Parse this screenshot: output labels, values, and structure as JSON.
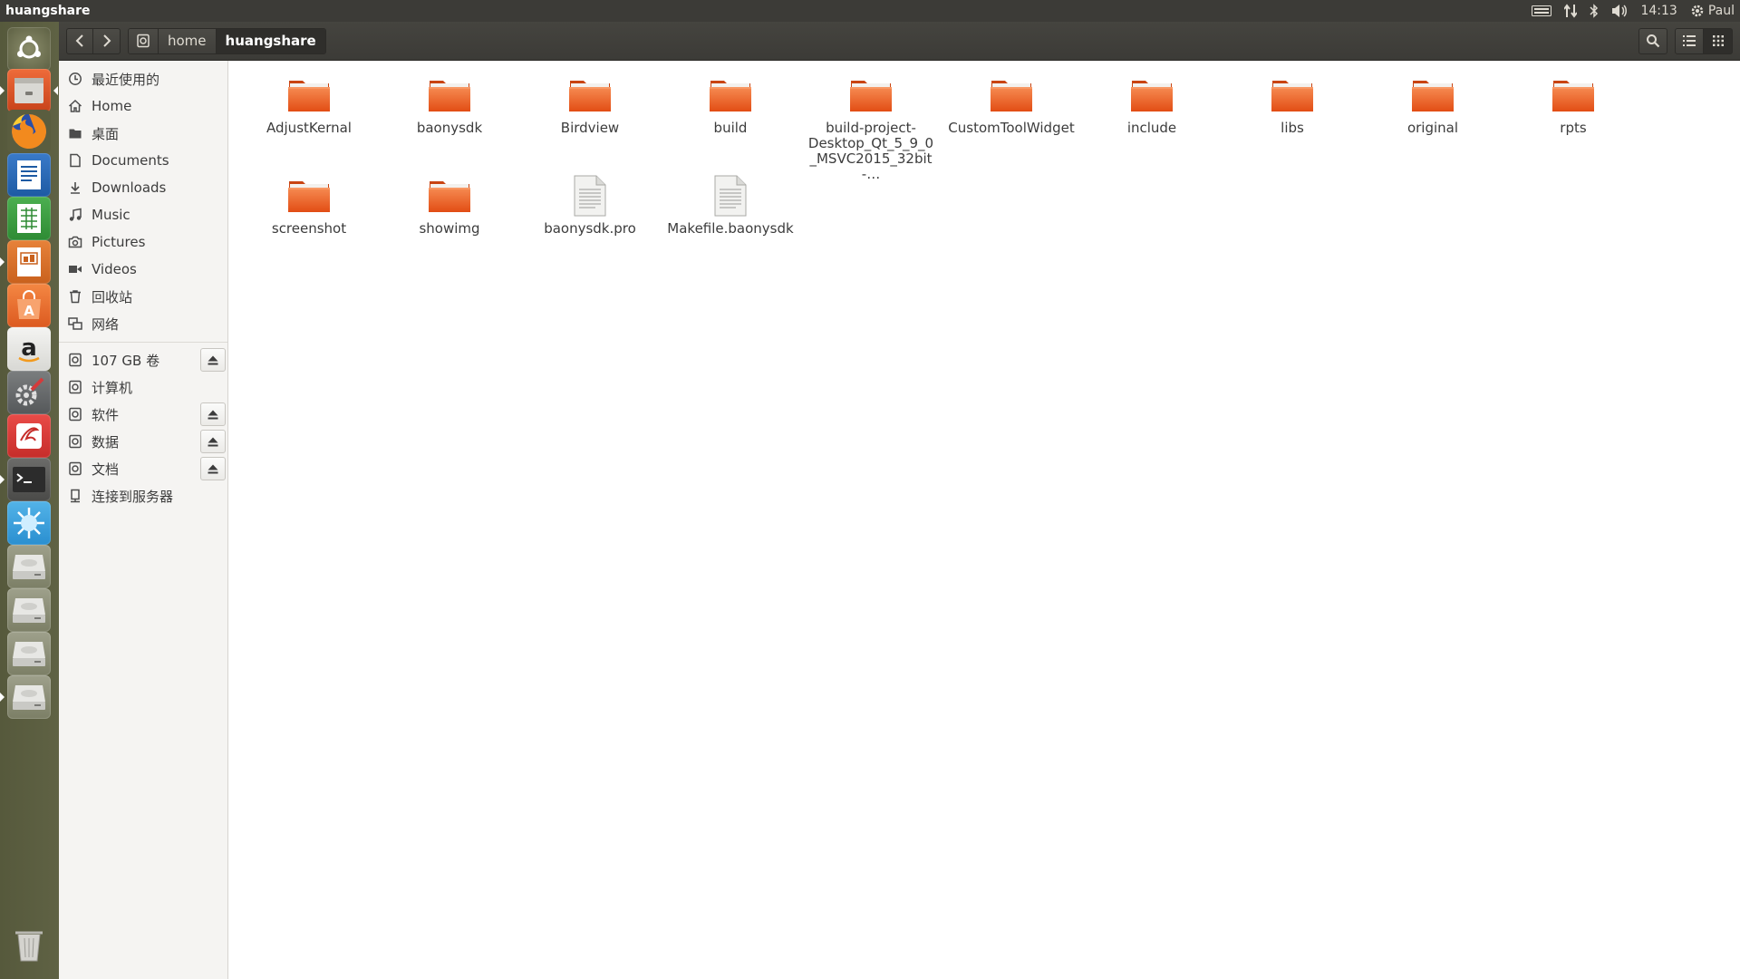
{
  "window": {
    "title": "huangshare"
  },
  "indicators": {
    "time": "14:13",
    "user": "Paul"
  },
  "pathbar": {
    "crumbs": [
      "home",
      "huangshare"
    ]
  },
  "sidebar": {
    "places": [
      {
        "label": "最近使用的",
        "icon": "clock-icon"
      },
      {
        "label": "Home",
        "icon": "home-icon"
      },
      {
        "label": "桌面",
        "icon": "folder-icon"
      },
      {
        "label": "Documents",
        "icon": "document-icon"
      },
      {
        "label": "Downloads",
        "icon": "download-icon"
      },
      {
        "label": "Music",
        "icon": "music-icon"
      },
      {
        "label": "Pictures",
        "icon": "camera-icon"
      },
      {
        "label": "Videos",
        "icon": "video-icon"
      },
      {
        "label": "回收站",
        "icon": "trash-icon"
      },
      {
        "label": "网络",
        "icon": "network-icon"
      }
    ],
    "devices": [
      {
        "label": "107 GB 卷",
        "icon": "drive-icon",
        "eject": true
      },
      {
        "label": "计算机",
        "icon": "drive-icon",
        "eject": false
      },
      {
        "label": "软件",
        "icon": "drive-icon",
        "eject": true
      },
      {
        "label": "数据",
        "icon": "drive-icon",
        "eject": true
      },
      {
        "label": "文档",
        "icon": "drive-icon",
        "eject": true
      },
      {
        "label": "连接到服务器",
        "icon": "server-icon",
        "eject": false
      }
    ]
  },
  "files": [
    {
      "name": "AdjustKernal",
      "type": "folder"
    },
    {
      "name": "baonysdk",
      "type": "folder"
    },
    {
      "name": "Birdview",
      "type": "folder"
    },
    {
      "name": "build",
      "type": "folder"
    },
    {
      "name": "build-project-Desktop_Qt_5_9_0_MSVC2015_32bit-…",
      "type": "folder"
    },
    {
      "name": "CustomToolWidget",
      "type": "folder"
    },
    {
      "name": "include",
      "type": "folder"
    },
    {
      "name": "libs",
      "type": "folder"
    },
    {
      "name": "original",
      "type": "folder"
    },
    {
      "name": "rpts",
      "type": "folder"
    },
    {
      "name": "screenshot",
      "type": "folder"
    },
    {
      "name": "showimg",
      "type": "folder"
    },
    {
      "name": "baonysdk.pro",
      "type": "file"
    },
    {
      "name": "Makefile.baonysdk",
      "type": "file"
    }
  ],
  "launcher": [
    "ubuntu-dash-icon",
    "files-app-icon",
    "firefox-icon",
    "writer-icon",
    "calc-icon",
    "impress-icon",
    "software-center-icon",
    "amazon-icon",
    "system-settings-icon",
    "wps-icon",
    "terminal-icon",
    "weather-icon",
    "drive-icon",
    "drive-icon",
    "drive-icon",
    "drive-icon",
    "trash-icon"
  ],
  "colors": {
    "accent": "#e95420",
    "panel": "#3c3b37",
    "launcher": "#5a5d3f"
  }
}
